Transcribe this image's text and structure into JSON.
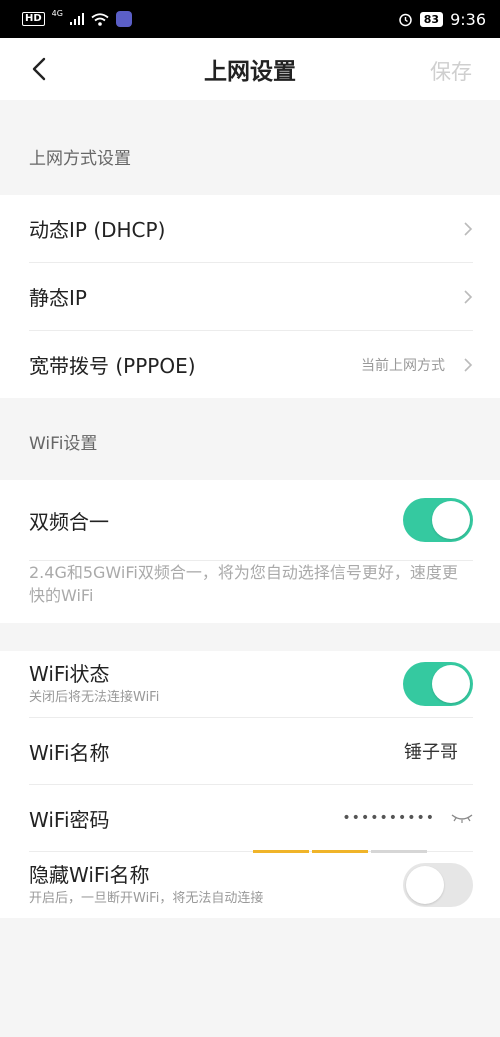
{
  "status_bar": {
    "hd": "HD",
    "network": "4G",
    "battery": "83",
    "time": "9:36"
  },
  "nav": {
    "title": "上网设置",
    "save": "保存"
  },
  "connection_section": {
    "label": "上网方式设置",
    "items": [
      {
        "label": "动态IP (DHCP)",
        "hint": ""
      },
      {
        "label": "静态IP",
        "hint": ""
      },
      {
        "label": "宽带拨号 (PPPOE)",
        "hint": "当前上网方式"
      }
    ]
  },
  "wifi_section": {
    "label": "WiFi设置",
    "dual_band": {
      "label": "双频合一",
      "enabled": true,
      "description": "2.4G和5GWiFi双频合一，将为您自动选择信号更好，速度更快的WiFi"
    },
    "wifi_status": {
      "label": "WiFi状态",
      "sub": "关闭后将无法连接WiFi",
      "enabled": true
    },
    "wifi_name": {
      "label": "WiFi名称",
      "value": "锤子哥"
    },
    "wifi_password": {
      "label": "WiFi密码",
      "value": "••••••••••",
      "strength_levels_filled": 2,
      "strength_levels_total": 3
    },
    "hide_ssid": {
      "label": "隐藏WiFi名称",
      "sub": "开启后，一旦断开WiFi，将无法自动连接",
      "enabled": false
    }
  },
  "colors": {
    "accent_toggle": "#35c9a0",
    "strength_on": "#f0b429",
    "strength_off": "#d6d6d6",
    "save_disabled": "#cfcfcf"
  },
  "icons": {
    "back": "chevron-left-icon",
    "row_arrow": "chevron-right-icon",
    "password_visibility": "eye-closed-icon"
  }
}
